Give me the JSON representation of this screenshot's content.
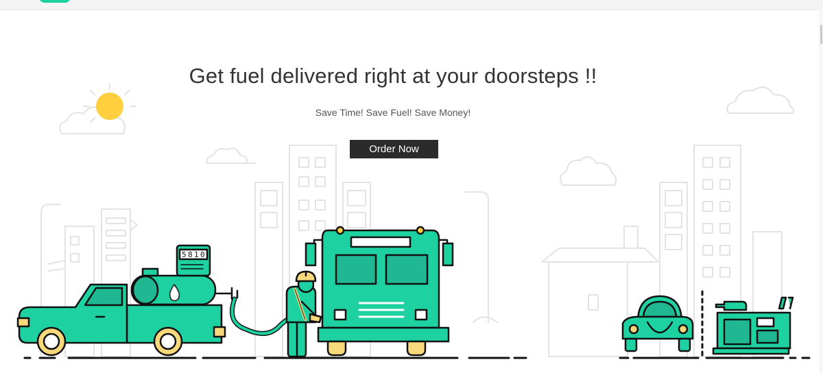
{
  "hero": {
    "headline": "Get fuel delivered right at your doorsteps !!",
    "tagline": "Save Time! Save Fuel! Save Money!",
    "cta_label": "Order Now"
  },
  "meter": {
    "digits": [
      "5",
      "8",
      "1",
      "0"
    ]
  },
  "colors": {
    "accent": "#1dd1a1",
    "accent_dark": "#111111",
    "sun": "#ffcf40",
    "wheel_hub": "#f7d87a",
    "sketch": "#e3e3e3",
    "button_bg": "#2b2b2b"
  },
  "icons": [
    "sun-icon",
    "cloud-icon",
    "fuel-drop-icon",
    "fuel-nozzle-icon"
  ]
}
